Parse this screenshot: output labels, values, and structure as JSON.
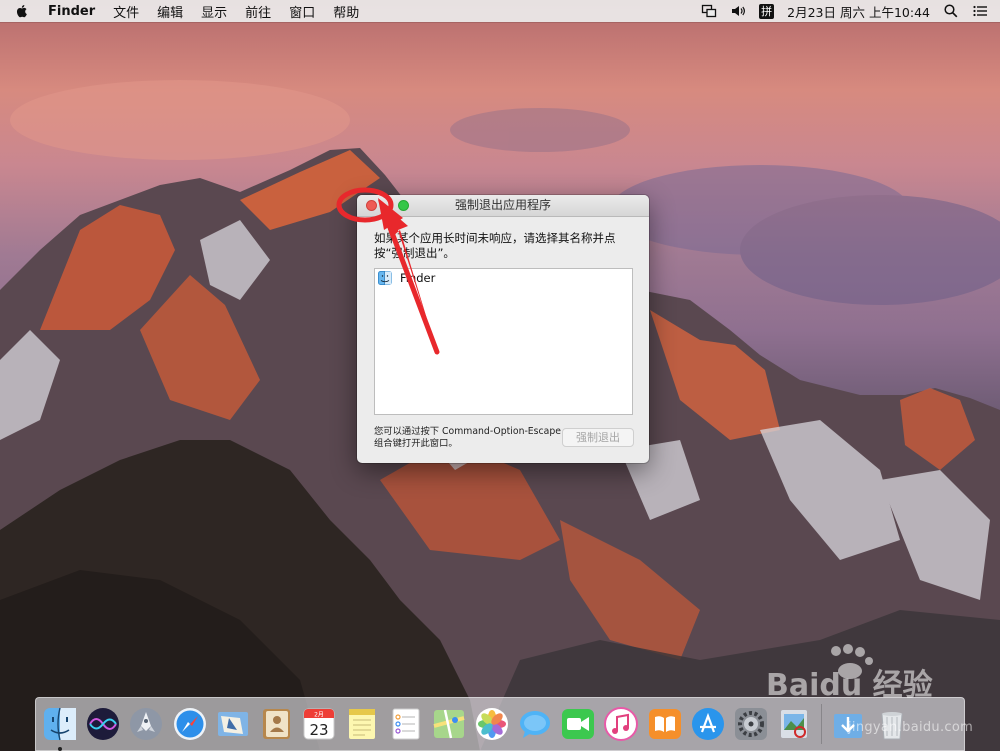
{
  "menubar": {
    "app_name": "Finder",
    "menus": [
      "文件",
      "编辑",
      "显示",
      "前往",
      "窗口",
      "帮助"
    ],
    "input_method": "拼",
    "datetime": "2月23日 周六 上午10:44"
  },
  "dialog": {
    "title": "强制退出应用程序",
    "message": "如果某个应用长时间未响应，请选择其名称并点按“强制退出”。",
    "apps": [
      "Finder"
    ],
    "hint": "您可以通过按下 Command-Option-Escape 组合键打开此窗口。",
    "force_quit_label": "强制退出"
  },
  "dock": {
    "icons": [
      "finder-icon",
      "siri-icon",
      "launchpad-icon",
      "safari-icon",
      "mail-icon",
      "contacts-icon",
      "calendar-icon",
      "notes-icon",
      "reminders-icon",
      "maps-icon",
      "photos-icon",
      "messages-icon",
      "facetime-icon",
      "itunes-icon",
      "ibooks-icon",
      "app-store-icon",
      "system-preferences-icon",
      "preview-icon",
      "downloads-icon",
      "trash-icon"
    ],
    "calendar_month": "2月",
    "calendar_day": "23"
  },
  "watermark": {
    "logo": "Baidu 经验",
    "url": "jingyan.baidu.com"
  },
  "colors": {
    "close": "#ee5b55",
    "zoom": "#34c748",
    "annotation": "#e8282c"
  }
}
